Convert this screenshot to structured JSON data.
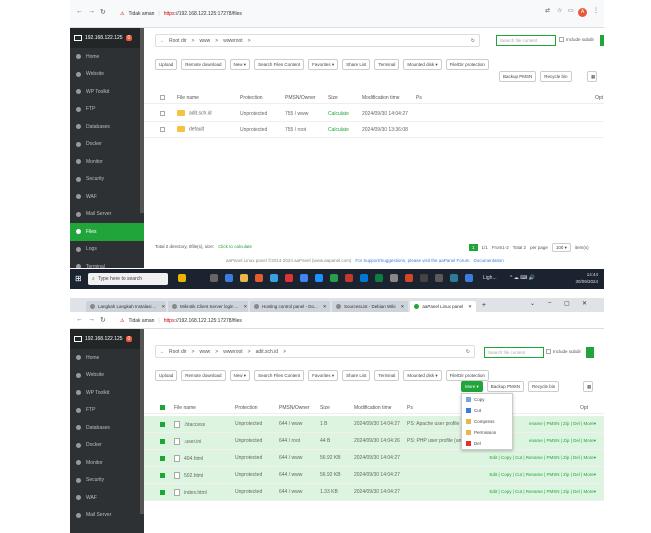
{
  "shot1": {
    "browser": {
      "warning": "Tidak aman",
      "url_scheme": "https",
      "url_rest": "://192.168.122.125:17278/files",
      "avatar": "A"
    },
    "sidebar": {
      "host": "192.168.122.125",
      "badge": "0",
      "items": [
        "Home",
        "Website",
        "WP Toolkit",
        "FTP",
        "Databases",
        "Docker",
        "Monitor",
        "Security",
        "WAF",
        "Mail Server",
        "Files",
        "Logs",
        "Terminal"
      ],
      "active": "Files"
    },
    "path": {
      "parts": [
        "Root dir",
        ">",
        "www",
        ">",
        "wwwroot",
        ">"
      ],
      "refresh": "↻"
    },
    "search": {
      "placeholder": "Search file content",
      "subdir_label": "Include subdir"
    },
    "toolbar": [
      "Upload",
      "Remote download",
      "New ▾",
      "Search Files Content",
      "Favorites ▾",
      "Share List",
      "Terminal",
      "Mounted disk ▾",
      "File/Dir protection"
    ],
    "toolbar2": [
      "Backup PMSN",
      "Recycle bin"
    ],
    "columns": [
      "File name",
      "Protection",
      "PMSN/Owner",
      "Size",
      "Modification time",
      "Ps",
      "Opt"
    ],
    "rows": [
      {
        "name": "adit.sch.id",
        "protection": "Unprotected",
        "pmsn": "755 / www",
        "size": "Calculate",
        "mtime": "2024/09/30 14:04:27"
      },
      {
        "name": "default",
        "protection": "Unprotected",
        "pmsn": "755 / root",
        "size": "Calculate",
        "mtime": "2024/09/30 13:36:08"
      }
    ],
    "footer_left": "Total 2 directory, 0file(s), size:",
    "footer_calc": "Click to calculate",
    "pagination": {
      "current": "1",
      "range": "1/1",
      "from": "From1-2",
      "total": "Total 2",
      "per_page": "per page",
      "per_value": "100 ▾",
      "items": "item(s)"
    },
    "copyright": "aaPanel Linux panel ©2014-2024 aaPanel (www.aapanel.com)",
    "suggest": "For Support/Suggestions, please visit the aaPanel Forum",
    "docs": "Documentation"
  },
  "taskbar": {
    "search_placeholder": "Type here to search",
    "weather": "Ligh...",
    "time": "14:44",
    "date": "30/09/2024"
  },
  "shot2": {
    "tabs": [
      {
        "label": "Langkah Langkah Instalasi ..."
      },
      {
        "label": "Mikrotik Client Server login ..."
      },
      {
        "label": "Hosting control panel - Do..."
      },
      {
        "label": "SourcesList - Debian Wiki"
      },
      {
        "label": "aaPanel Linux panel"
      }
    ],
    "new_tab": "+",
    "browser": {
      "warning": "Tidak aman",
      "url_scheme": "https",
      "url_rest": "://192.168.122.125:17278/files"
    },
    "sidebar": {
      "host": "192.168.122.125",
      "badge": "0",
      "items": [
        "Home",
        "Website",
        "WP Toolkit",
        "FTP",
        "Databases",
        "Docker",
        "Monitor",
        "Security",
        "WAF",
        "Mail Server"
      ]
    },
    "path": {
      "parts": [
        "Root dir",
        ">",
        "www",
        ">",
        "wwwroot",
        ">",
        "adit.sch.id",
        ">"
      ]
    },
    "search": {
      "placeholder": "Search file content",
      "subdir_label": "Include subdir"
    },
    "toolbar": [
      "Upload",
      "Remote download",
      "New ▾",
      "Search Files Content",
      "Favorites ▾",
      "Share List",
      "Terminal",
      "Mounted disk ▾",
      "File/Dir protection"
    ],
    "toolbar2": [
      "More ▾",
      "Backup PMSN",
      "Recycle bin"
    ],
    "columns": [
      "File name",
      "Protection",
      "PMSN/Owner",
      "Size",
      "Modification time",
      "Ps",
      "Opt"
    ],
    "rows": [
      {
        "name": ".htaccess",
        "protection": "Unprotected",
        "pmsn": "644 / www",
        "size": "1 B",
        "mtime": "2024/09/30 14:04:27",
        "ps": "PS: Apache user profile (URL r",
        "ops": "ename | PMSN | Zip | Del | More▾"
      },
      {
        "name": ".user.ini",
        "protection": "Unprotected",
        "pmsn": "644 / root",
        "size": "44 B",
        "mtime": "2024/09/30 14:04:26",
        "ps": "PS: PHP user profile (anti-cross",
        "ops": "ename | PMSN | Zip | Del | More▾"
      },
      {
        "name": "404.html",
        "protection": "Unprotected",
        "pmsn": "644 / www",
        "size": "56.92 KB",
        "mtime": "2024/09/30 14:04:27",
        "ps": "",
        "ops": "Edit | Copy | Cut | Rename | PMSN | Zip | Del | More▾"
      },
      {
        "name": "502.html",
        "protection": "Unprotected",
        "pmsn": "644 / www",
        "size": "56.92 KB",
        "mtime": "2024/09/30 14:04:27",
        "ps": "",
        "ops": "Edit | Copy | Cut | Rename | PMSN | Zip | Del | More▾"
      },
      {
        "name": "index.html",
        "protection": "Unprotected",
        "pmsn": "644 / www",
        "size": "1.33 KB",
        "mtime": "2024/09/30 14:04:27",
        "ps": "",
        "ops": "Edit | Copy | Cut | Rename | PMSN | Zip | Del | More▾"
      }
    ],
    "more_menu": [
      "Copy",
      "Cut",
      "Compress",
      "Permission",
      "Del"
    ]
  }
}
